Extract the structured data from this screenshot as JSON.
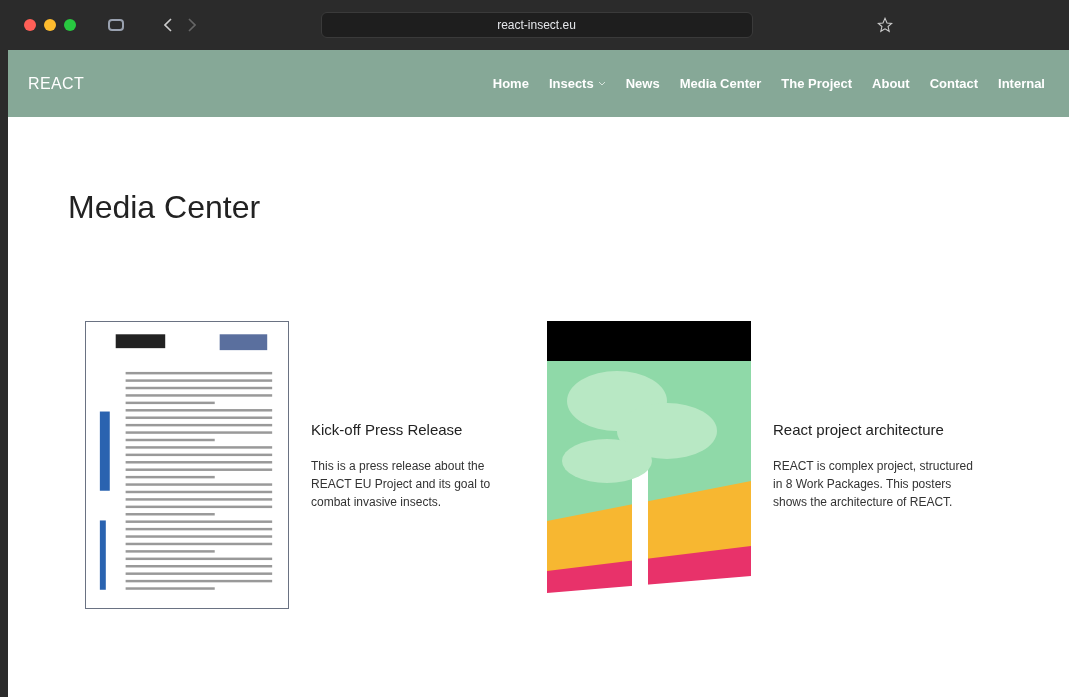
{
  "browser": {
    "url": "react-insect.eu"
  },
  "nav": {
    "logo": "REACT",
    "items": [
      {
        "label": "Home",
        "dropdown": false
      },
      {
        "label": "Insects",
        "dropdown": true
      },
      {
        "label": "News",
        "dropdown": false
      },
      {
        "label": "Media Center",
        "dropdown": false
      },
      {
        "label": "The Project",
        "dropdown": false
      },
      {
        "label": "About",
        "dropdown": false
      },
      {
        "label": "Contact",
        "dropdown": false
      },
      {
        "label": "Internal",
        "dropdown": false
      }
    ]
  },
  "page": {
    "title": "Media Center"
  },
  "media": [
    {
      "kind": "document",
      "title": "Kick-off Press Release",
      "description": "This is a press release about the REACT EU Project and its goal to combat invasive insects."
    },
    {
      "kind": "poster",
      "title": "React project architecture",
      "description": "REACT is complex project, structured in 8 Work Packages. This posters shows the architecture of REACT."
    }
  ]
}
